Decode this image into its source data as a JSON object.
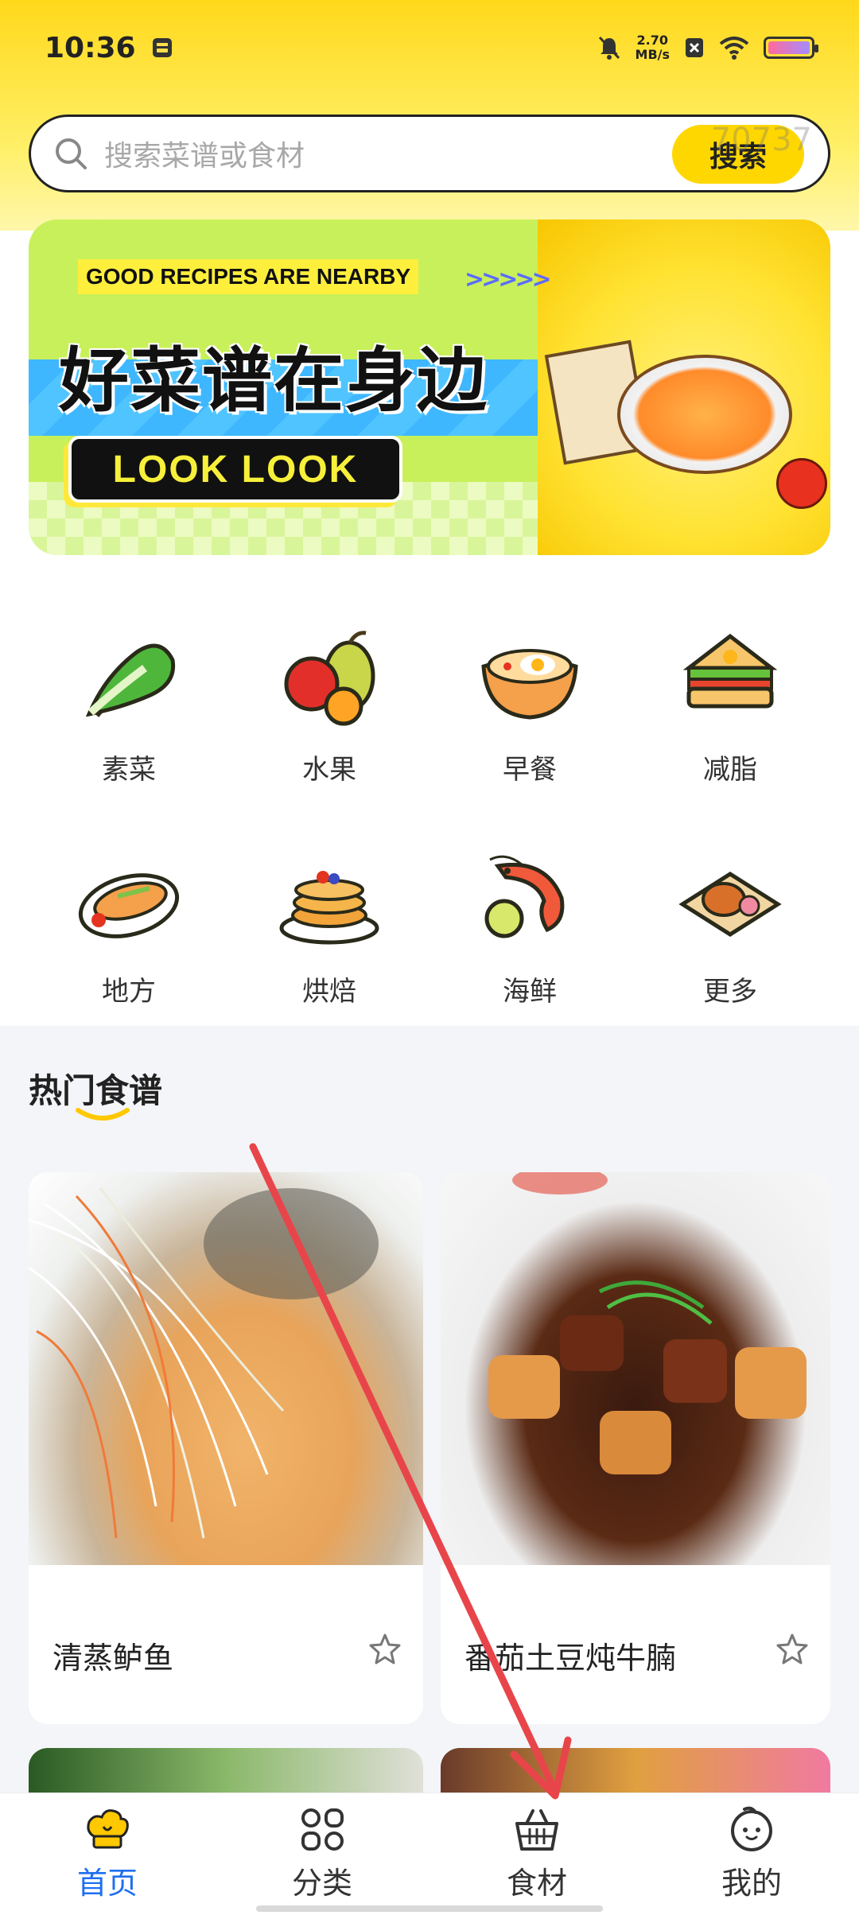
{
  "status_bar": {
    "time": "10:36",
    "net_speed_value": "2.70",
    "net_speed_unit": "MB/s"
  },
  "search": {
    "placeholder": "搜索菜谱或食材",
    "button_label": "搜索",
    "watermark": "70737"
  },
  "banner": {
    "en_text": "GOOD RECIPES ARE NEARBY",
    "arrows": ">>>>>",
    "cn_text": "好菜谱在身边",
    "look_text": "LOOK LOOK"
  },
  "categories": [
    {
      "label": "素菜",
      "icon": "vegetable-icon"
    },
    {
      "label": "水果",
      "icon": "fruit-icon"
    },
    {
      "label": "早餐",
      "icon": "breakfast-icon"
    },
    {
      "label": "减脂",
      "icon": "sandwich-icon"
    },
    {
      "label": "地方",
      "icon": "local-dish-icon"
    },
    {
      "label": "烘焙",
      "icon": "pancake-icon"
    },
    {
      "label": "海鲜",
      "icon": "shrimp-icon"
    },
    {
      "label": "更多",
      "icon": "more-food-icon"
    }
  ],
  "hot_section": {
    "title": "热门食谱"
  },
  "recipes": [
    {
      "title": "清蒸鲈鱼"
    },
    {
      "title": "番茄土豆炖牛腩"
    }
  ],
  "nav": [
    {
      "label": "首页",
      "icon": "chef-hat-icon",
      "active": true
    },
    {
      "label": "分类",
      "icon": "category-grid-icon",
      "active": false
    },
    {
      "label": "食材",
      "icon": "basket-icon",
      "active": false
    },
    {
      "label": "我的",
      "icon": "profile-icon",
      "active": false
    }
  ],
  "colors": {
    "accent_yellow": "#ffd700",
    "active_blue": "#1e6ff0",
    "annotation_red": "#e8454a"
  }
}
